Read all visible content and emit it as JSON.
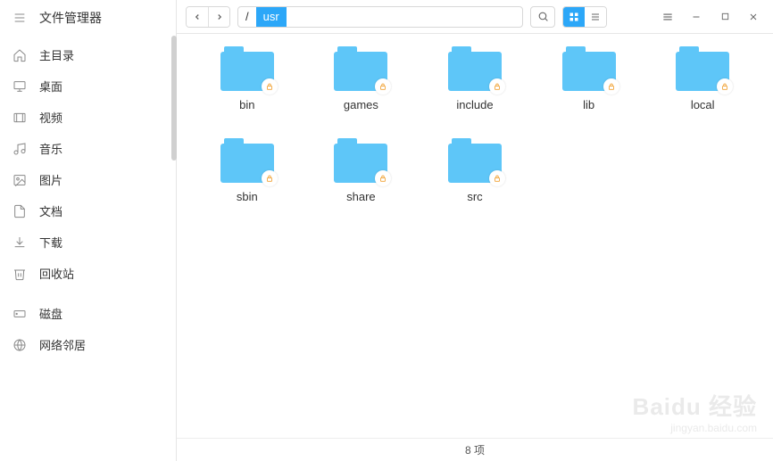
{
  "app": {
    "title": "文件管理器"
  },
  "sidebar": {
    "items": [
      {
        "label": "主目录"
      },
      {
        "label": "桌面"
      },
      {
        "label": "视频"
      },
      {
        "label": "音乐"
      },
      {
        "label": "图片"
      },
      {
        "label": "文档"
      },
      {
        "label": "下载"
      },
      {
        "label": "回收站"
      }
    ],
    "disks_header": "磁盘",
    "network_header": "网络邻居"
  },
  "toolbar": {
    "path_root": "/",
    "path_current": "usr"
  },
  "folders": [
    {
      "name": "bin"
    },
    {
      "name": "games"
    },
    {
      "name": "include"
    },
    {
      "name": "lib"
    },
    {
      "name": "local"
    },
    {
      "name": "sbin"
    },
    {
      "name": "share"
    },
    {
      "name": "src"
    }
  ],
  "status": {
    "text": "8 项"
  },
  "watermark": {
    "main": "Baidu 经验",
    "sub": "jingyan.baidu.com"
  }
}
